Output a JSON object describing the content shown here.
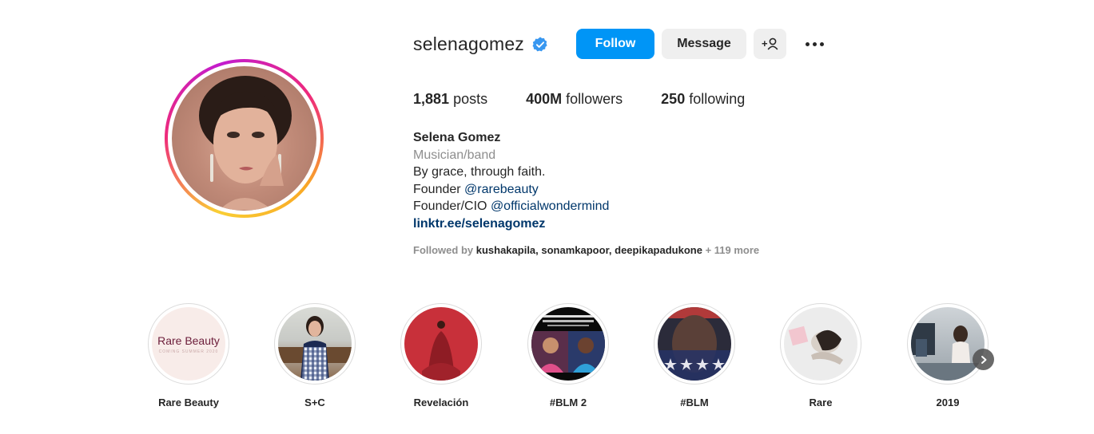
{
  "profile": {
    "username": "selenagomez",
    "follow_label": "Follow",
    "message_label": "Message",
    "add_user_glyph": "+",
    "stats": {
      "posts_count": "1,881",
      "posts_label": "posts",
      "followers_count": "400M",
      "followers_label": "followers",
      "following_count": "250",
      "following_label": "following"
    },
    "bio": {
      "name": "Selena Gomez",
      "category": "Musician/band",
      "line1": "By grace, through faith.",
      "line2_prefix": "Founder ",
      "line2_mention": "@rarebeauty",
      "line3_prefix": "Founder/CIO ",
      "line3_mention": "@officialwondermind",
      "link": "linktr.ee/selenagomez"
    },
    "followed_by": {
      "prefix": "Followed by ",
      "users": "kushakapila, sonamkapoor, deepikapadukone",
      "more": " + 119 more"
    }
  },
  "highlights": [
    {
      "label": "Rare Beauty",
      "cover_text": "Rare Beauty",
      "cover_sub": "COMING SUMMER 2020"
    },
    {
      "label": "S+C"
    },
    {
      "label": "Revelación"
    },
    {
      "label": "#BLM 2"
    },
    {
      "label": "#BLM"
    },
    {
      "label": "Rare"
    },
    {
      "label": "2019"
    }
  ],
  "icons": {
    "verified": "verified-badge-icon",
    "more": "more-options-icon",
    "add_user": "add-user-icon",
    "next": "chevron-right-icon"
  },
  "colors": {
    "accent": "#0095f6",
    "link": "#00376b",
    "secondary_text": "#8e8e8e",
    "button_bg": "#efefef"
  }
}
